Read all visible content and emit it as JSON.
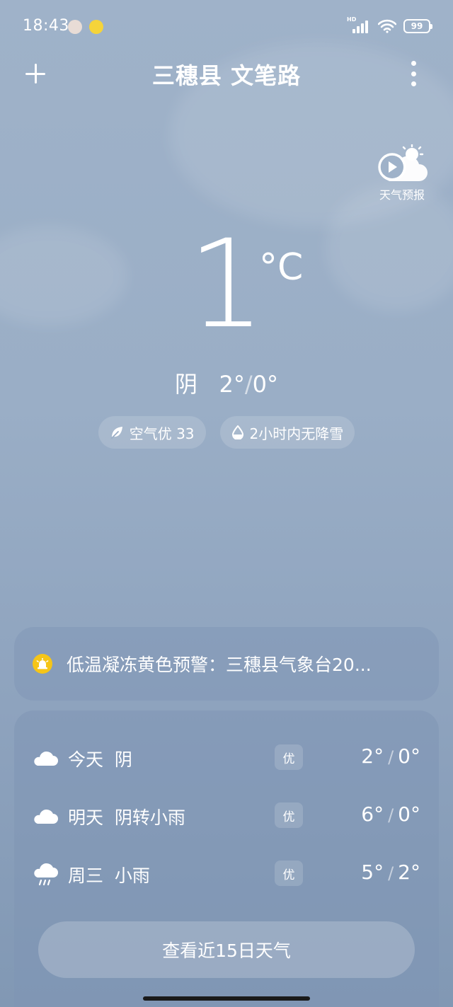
{
  "status_bar": {
    "time": "18:43",
    "network_label": "HD",
    "battery": "99"
  },
  "header": {
    "location": "三穗县 文笔路"
  },
  "forecast_video": {
    "label": "天气预报"
  },
  "current": {
    "temperature": "1",
    "unit": "°C",
    "condition": "阴",
    "high": "2°",
    "low": "0°"
  },
  "chips": {
    "air_quality": "空气优 33",
    "precipitation": "2小时内无降雪"
  },
  "alert": {
    "text": "低温凝冻黄色预警：三穗县气象台20..."
  },
  "forecast": {
    "days": [
      {
        "day": "今天",
        "condition": "阴",
        "icon": "cloud-icon",
        "aqi": "优",
        "high": "2°",
        "low": "0°"
      },
      {
        "day": "明天",
        "condition": "阴转小雨",
        "icon": "cloud-icon",
        "aqi": "优",
        "high": "6°",
        "low": "0°"
      },
      {
        "day": "周三",
        "condition": "小雨",
        "icon": "rain-cloud-icon",
        "aqi": "优",
        "high": "5°",
        "low": "2°"
      }
    ],
    "more_button": "查看近15日天气"
  },
  "colors": {
    "background_top": "#9fb2c9",
    "background_bottom": "#8198b4",
    "alert_icon": "#f5c518"
  }
}
